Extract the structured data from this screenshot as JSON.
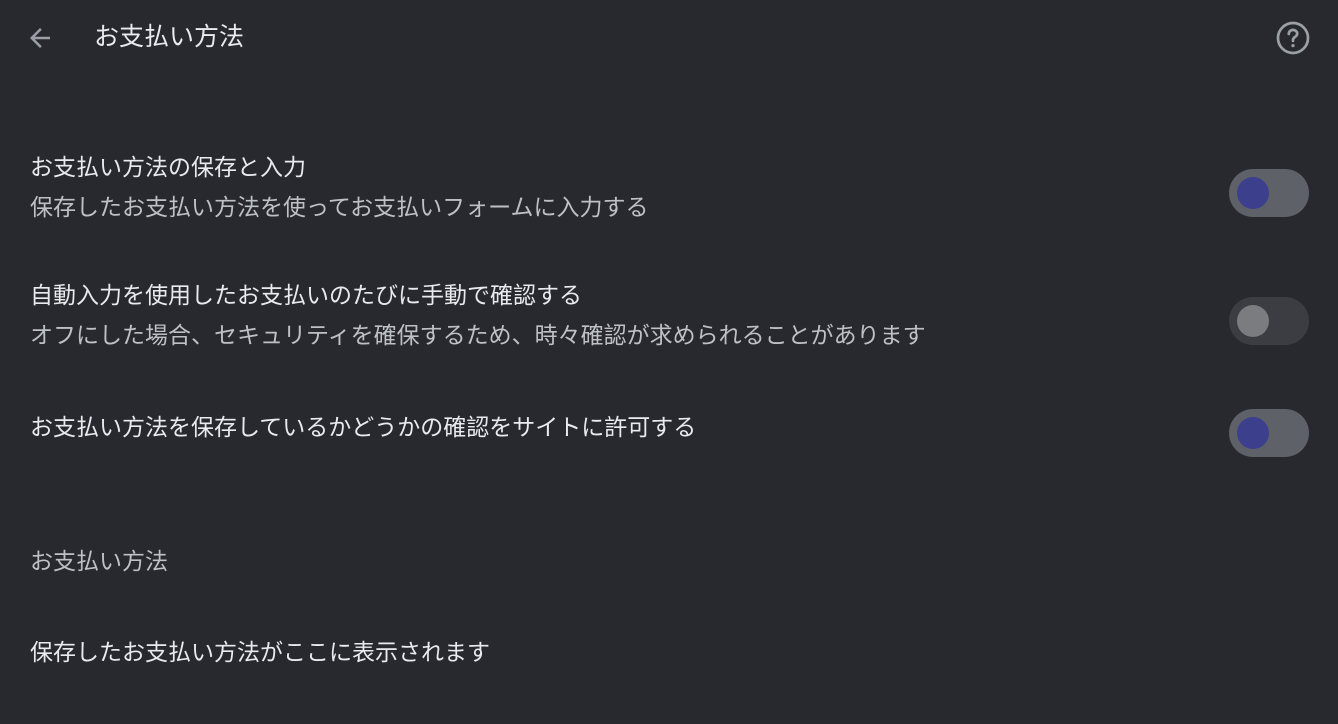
{
  "header": {
    "title": "お支払い方法",
    "back_icon": "arrow-back-icon",
    "help_icon": "help-circle-icon"
  },
  "settings": [
    {
      "title": "お支払い方法の保存と入力",
      "subtitle": "保存したお支払い方法を使ってお支払いフォームに入力する",
      "enabled": true
    },
    {
      "title": "自動入力を使用したお支払いのたびに手動で確認する",
      "subtitle": "オフにした場合、セキュリティを確保するため、時々確認が求められることがあります",
      "enabled": false
    },
    {
      "title": "お支払い方法を保存しているかどうかの確認をサイトに許可する",
      "enabled": true
    }
  ],
  "payment_methods": {
    "section_title": "お支払い方法",
    "empty_message": "保存したお支払い方法がここに表示されます"
  },
  "colors": {
    "background": "#28292e",
    "toggle_on_track": "#5f6168",
    "toggle_on_knob": "#3c3f8c",
    "toggle_off_track": "#3c3d42",
    "toggle_off_knob": "#7b7c80"
  }
}
